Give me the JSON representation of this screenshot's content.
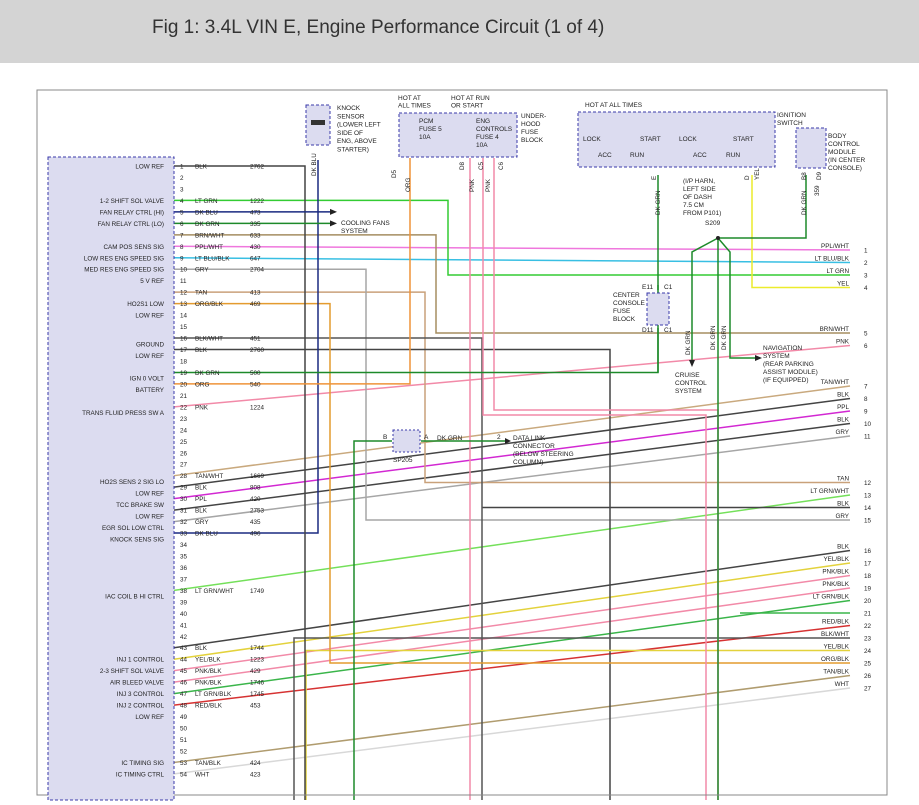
{
  "title": "Fig 1: 3.4L VIN E, Engine Performance Circuit (1 of 4)",
  "colors": {
    "DK BLU": "#1a2a80",
    "LT GRN": "#33cc33",
    "DK GRN": "#1d8a2a",
    "BRN/WHT": "#a58d60",
    "PPL/WHT": "#ef77dd",
    "LT BLU/BLK": "#38bfe3",
    "GRY": "#a6a6a6",
    "TAN": "#c9a17a",
    "ORG/BLK": "#e49b2f",
    "BLK/WHT": "#555555",
    "BLK": "#444444",
    "ORG": "#ef9339",
    "PNK": "#f28aa8",
    "TAN/WHT": "#c9a97e",
    "PPL": "#d228d2",
    "LT GRN/WHT": "#74e05a",
    "YEL/BLK": "#e3d23c",
    "PNK/BLK": "#f28aa8",
    "LT GRN/BLK": "#3ab54a",
    "RED/BLK": "#d63232",
    "YEL": "#ecec2c",
    "TAN/BLK": "#b09c6f",
    "WHT": "#d8d8d8"
  },
  "pcm": {
    "side_labels": [
      {
        "pin": 1,
        "text": "LOW REF"
      },
      {
        "pin": 4,
        "text": "1-2 SHIFT SOL VALVE"
      },
      {
        "pin": 5,
        "text": "FAN RELAY CTRL (HI)"
      },
      {
        "pin": 6,
        "text": "FAN RELAY CTRL (LO)"
      },
      {
        "pin": 8,
        "text": "CAM POS SENS SIG"
      },
      {
        "pin": 9,
        "text": "LOW RES ENG SPEED SIG"
      },
      {
        "pin": 10,
        "text": "MED RES ENG SPEED SIG"
      },
      {
        "pin": 11,
        "text": "5 V REF"
      },
      {
        "pin": 13,
        "text": "HO2S1 LOW"
      },
      {
        "pin": 14,
        "text": "LOW REF"
      },
      {
        "pin": 16.5,
        "text": "GROUND"
      },
      {
        "pin": 17.5,
        "text": "LOW REF"
      },
      {
        "pin": 19.5,
        "text": "IGN 0 VOLT"
      },
      {
        "pin": 20.5,
        "text": "BATTERY"
      },
      {
        "pin": 22.5,
        "text": "TRANS FLUID PRESS SW A"
      },
      {
        "pin": 28.5,
        "text": "HO2S SENS 2 SIG LO"
      },
      {
        "pin": 29.5,
        "text": "LOW REF"
      },
      {
        "pin": 30.5,
        "text": "TCC BRAKE SW"
      },
      {
        "pin": 31.5,
        "text": "LOW REF"
      },
      {
        "pin": 32.5,
        "text": "EGR SOL LOW CTRL"
      },
      {
        "pin": 33.5,
        "text": "KNOCK SENS SIG"
      },
      {
        "pin": 38.5,
        "text": "IAC COIL B HI CTRL"
      },
      {
        "pin": 44,
        "text": "INJ 1 CONTROL"
      },
      {
        "pin": 45,
        "text": "2-3 SHIFT SOL VALVE"
      },
      {
        "pin": 46,
        "text": "AIR BLEED VALVE"
      },
      {
        "pin": 47,
        "text": "INJ 3 CONTROL"
      },
      {
        "pin": 48,
        "text": "INJ 2 CONTROL"
      },
      {
        "pin": 49,
        "text": "LOW REF"
      },
      {
        "pin": 53,
        "text": "IC TIMING SIG"
      },
      {
        "pin": 54,
        "text": "IC TIMING CTRL"
      }
    ],
    "pins": [
      {
        "n": "1",
        "color": "BLK",
        "circuit": "2762"
      },
      {
        "n": "2",
        "color": "",
        "circuit": ""
      },
      {
        "n": "3",
        "color": "",
        "circuit": ""
      },
      {
        "n": "4",
        "color": "LT GRN",
        "circuit": "1222"
      },
      {
        "n": "5",
        "color": "DK BLU",
        "circuit": "473"
      },
      {
        "n": "6",
        "color": "DK GRN",
        "circuit": "335"
      },
      {
        "n": "7",
        "color": "BRN/WHT",
        "circuit": "633"
      },
      {
        "n": "8",
        "color": "PPL/WHT",
        "circuit": "430"
      },
      {
        "n": "9",
        "color": "LT BLU/BLK",
        "circuit": "647"
      },
      {
        "n": "10",
        "color": "GRY",
        "circuit": "2704"
      },
      {
        "n": "11",
        "color": "",
        "circuit": ""
      },
      {
        "n": "12",
        "color": "TAN",
        "circuit": "413"
      },
      {
        "n": "13",
        "color": "ORG/BLK",
        "circuit": "469"
      },
      {
        "n": "14",
        "color": "",
        "circuit": ""
      },
      {
        "n": "15",
        "color": "",
        "circuit": ""
      },
      {
        "n": "16",
        "color": "BLK/WHT",
        "circuit": "451"
      },
      {
        "n": "17",
        "color": "BLK",
        "circuit": "2760"
      },
      {
        "n": "18",
        "color": "",
        "circuit": ""
      },
      {
        "n": "19",
        "color": "DK GRN",
        "circuit": "500"
      },
      {
        "n": "20",
        "color": "ORG",
        "circuit": "540"
      },
      {
        "n": "21",
        "color": "",
        "circuit": ""
      },
      {
        "n": "22",
        "color": "PNK",
        "circuit": "1224"
      },
      {
        "n": "23",
        "color": "",
        "circuit": ""
      },
      {
        "n": "24",
        "color": "",
        "circuit": ""
      },
      {
        "n": "25",
        "color": "",
        "circuit": ""
      },
      {
        "n": "26",
        "color": "",
        "circuit": ""
      },
      {
        "n": "27",
        "color": "",
        "circuit": ""
      },
      {
        "n": "28",
        "color": "TAN/WHT",
        "circuit": "1669"
      },
      {
        "n": "29",
        "color": "BLK",
        "circuit": "808"
      },
      {
        "n": "30",
        "color": "PPL",
        "circuit": "420"
      },
      {
        "n": "31",
        "color": "BLK",
        "circuit": "2753"
      },
      {
        "n": "32",
        "color": "GRY",
        "circuit": "435"
      },
      {
        "n": "33",
        "color": "DK BLU",
        "circuit": "496"
      },
      {
        "n": "34",
        "color": "",
        "circuit": ""
      },
      {
        "n": "35",
        "color": "",
        "circuit": ""
      },
      {
        "n": "36",
        "color": "",
        "circuit": ""
      },
      {
        "n": "37",
        "color": "",
        "circuit": ""
      },
      {
        "n": "38",
        "color": "LT GRN/WHT",
        "circuit": "1749"
      },
      {
        "n": "39",
        "color": "",
        "circuit": ""
      },
      {
        "n": "40",
        "color": "",
        "circuit": ""
      },
      {
        "n": "41",
        "color": "",
        "circuit": ""
      },
      {
        "n": "42",
        "color": "",
        "circuit": ""
      },
      {
        "n": "43",
        "color": "BLK",
        "circuit": "1744"
      },
      {
        "n": "44",
        "color": "YEL/BLK",
        "circuit": "1223"
      },
      {
        "n": "45",
        "color": "PNK/BLK",
        "circuit": "429"
      },
      {
        "n": "46",
        "color": "PNK/BLK",
        "circuit": "1746"
      },
      {
        "n": "47",
        "color": "LT GRN/BLK",
        "circuit": "1745"
      },
      {
        "n": "48",
        "color": "RED/BLK",
        "circuit": "453"
      },
      {
        "n": "49",
        "color": "",
        "circuit": ""
      },
      {
        "n": "50",
        "color": "",
        "circuit": ""
      },
      {
        "n": "51",
        "color": "",
        "circuit": ""
      },
      {
        "n": "52",
        "color": "",
        "circuit": ""
      },
      {
        "n": "53",
        "color": "TAN/BLK",
        "circuit": "424"
      },
      {
        "n": "54",
        "color": "WHT",
        "circuit": "423"
      }
    ]
  },
  "right_terminals": [
    {
      "n": "1",
      "label": "PPL/WHT",
      "color": "PPL/WHT"
    },
    {
      "n": "2",
      "label": "LT BLU/BLK",
      "color": "LT BLU/BLK"
    },
    {
      "n": "3",
      "label": "LT GRN",
      "color": "LT GRN"
    },
    {
      "n": "4",
      "label": "YEL",
      "color": "YEL"
    },
    {
      "n": "5",
      "label": "BRN/WHT",
      "color": "BRN/WHT"
    },
    {
      "n": "6",
      "label": "PNK",
      "color": "PNK"
    },
    {
      "n": "7",
      "label": "TAN/WHT",
      "color": "TAN/WHT"
    },
    {
      "n": "8",
      "label": "BLK",
      "color": "BLK"
    },
    {
      "n": "9",
      "label": "PPL",
      "color": "PPL"
    },
    {
      "n": "10",
      "label": "BLK",
      "color": "BLK"
    },
    {
      "n": "11",
      "label": "GRY",
      "color": "GRY"
    },
    {
      "n": "12",
      "label": "TAN",
      "color": "TAN"
    },
    {
      "n": "13",
      "label": "LT GRN/WHT",
      "color": "LT GRN/WHT"
    },
    {
      "n": "14",
      "label": "BLK",
      "color": "BLK"
    },
    {
      "n": "15",
      "label": "GRY",
      "color": "GRY"
    },
    {
      "n": "16",
      "label": "BLK",
      "color": "BLK"
    },
    {
      "n": "17",
      "label": "YEL/BLK",
      "color": "YEL/BLK"
    },
    {
      "n": "18",
      "label": "PNK/BLK",
      "color": "PNK/BLK"
    },
    {
      "n": "19",
      "label": "PNK/BLK",
      "color": "PNK/BLK"
    },
    {
      "n": "20",
      "label": "LT GRN/BLK",
      "color": "LT GRN/BLK"
    },
    {
      "n": "21",
      "label": "",
      "color": "LT GRN/BLK"
    },
    {
      "n": "22",
      "label": "RED/BLK",
      "color": "RED/BLK"
    },
    {
      "n": "23",
      "label": "BLK/WHT",
      "color": "BLK/WHT"
    },
    {
      "n": "24",
      "label": "YEL/BLK",
      "color": "YEL/BLK"
    },
    {
      "n": "25",
      "label": "ORG/BLK",
      "color": "ORG/BLK"
    },
    {
      "n": "26",
      "label": "TAN/BLK",
      "color": "TAN/BLK"
    },
    {
      "n": "27",
      "label": "WHT",
      "color": "WHT"
    }
  ],
  "components": {
    "knock_sensor": [
      "KNOCK",
      "SENSOR",
      "(LOWER LEFT",
      "SIDE OF",
      "ENG, ABOVE",
      "STARTER)"
    ],
    "hot_all_times_1": [
      "HOT AT",
      "ALL TIMES"
    ],
    "hot_run_start": [
      "HOT AT RUN",
      "OR START"
    ],
    "pcm_fuse": [
      "PCM",
      "FUSE 5",
      "10A"
    ],
    "eng_fuse": [
      "ENG",
      "CONTROLS",
      "FUSE 4",
      "10A"
    ],
    "underhood": [
      "UNDER-",
      "HOOD",
      "FUSE",
      "BLOCK"
    ],
    "hot_all_times_2": "HOT AT ALL TIMES",
    "ignition_switch": [
      "IGNITION",
      "SWITCH"
    ],
    "ign_positions": [
      "LOCK",
      "START",
      "ACC",
      "RUN",
      "LOCK",
      "START",
      "ACC",
      "RUN"
    ],
    "bcm": [
      "BODY",
      "CONTROL",
      "MODULE",
      "(IN CENTER",
      "CONSOLE)"
    ],
    "harness": [
      "(I/P HARN,",
      "LEFT SIDE",
      "OF DASH",
      "7.5 CM",
      "FROM P101)"
    ],
    "splice_s209": "S209",
    "cooling_fans": [
      "COOLING FANS",
      "SYSTEM"
    ],
    "console_fuse": [
      "CENTER",
      "CONSOLE",
      "FUSE",
      "BLOCK"
    ],
    "console_pins": [
      "E11",
      "C1",
      "D11",
      "C1"
    ],
    "navigation": [
      "NAVIGATION",
      "SYSTEM",
      "(REAR PARKING",
      "ASSIST MODULE)",
      "(IF EQUIPPED)"
    ],
    "cruise": [
      "CRUISE",
      "CONTROL",
      "SYSTEM"
    ],
    "dlc": [
      "DATA LINK",
      "CONNECTOR",
      "(BELOW STEERING",
      "COLUMN)"
    ],
    "sp205": "SP205",
    "sp205_pins": [
      "B",
      "A",
      "2"
    ],
    "sp205_wire": "DK GRN",
    "vert_wire_labels": [
      {
        "id": "ks",
        "text": "DK BLU"
      },
      {
        "id": "d5",
        "text": "D5"
      },
      {
        "id": "org",
        "text": "ORG"
      },
      {
        "id": "d8",
        "text": "D8"
      },
      {
        "id": "pnk1",
        "text": "PNK"
      },
      {
        "id": "c5",
        "text": "C5"
      },
      {
        "id": "pnk2",
        "text": "PNK"
      },
      {
        "id": "c6",
        "text": "C6"
      },
      {
        "id": "e",
        "text": "E"
      },
      {
        "id": "dkgrn1",
        "text": "DK GRN"
      },
      {
        "id": "d",
        "text": "D"
      },
      {
        "id": "yel",
        "text": "YEL"
      },
      {
        "id": "b8",
        "text": "B8"
      },
      {
        "id": "dkgrn2",
        "text": "DK GRN"
      },
      {
        "id": "d9",
        "text": "D9"
      },
      {
        "id": "n359",
        "text": "359"
      },
      {
        "id": "dkgrn3",
        "text": "DK GRN"
      },
      {
        "id": "dkgrn4",
        "text": "DK GRN"
      },
      {
        "id": "dkgrn5",
        "text": "DK GRN"
      }
    ]
  }
}
